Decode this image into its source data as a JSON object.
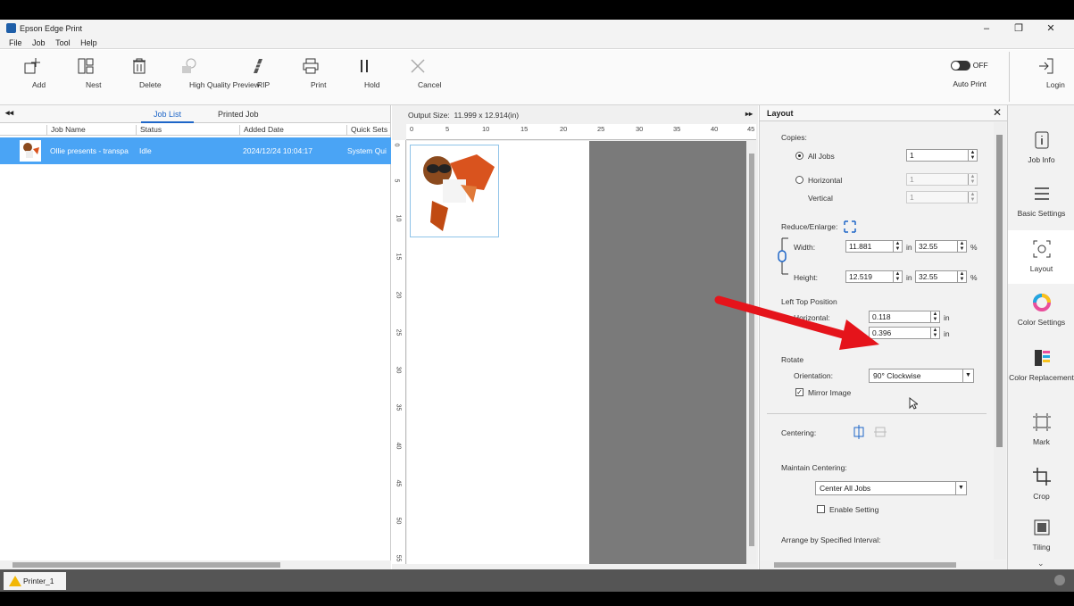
{
  "window": {
    "title": "Epson Edge Print",
    "min": "–",
    "restore": "❐",
    "close": "✕"
  },
  "menu": [
    "File",
    "Job",
    "Tool",
    "Help"
  ],
  "toolbar": {
    "add": "Add",
    "nest": "Nest",
    "delete": "Delete",
    "hq_preview": "High Quality Preview",
    "rip": "RIP",
    "print": "Print",
    "hold": "Hold",
    "cancel": "Cancel",
    "auto_print_state": "OFF",
    "auto_print": "Auto Print",
    "login": "Login"
  },
  "joblist": {
    "collapse": "◂◂",
    "tab_job_list": "Job List",
    "tab_printed_job": "Printed Job",
    "columns": [
      "Job Name",
      "Status",
      "Added Date",
      "Quick Sets"
    ],
    "rows": [
      {
        "name": "Ollie presents - transpa",
        "status": "Idle",
        "added": "2024/12/24 10:04:17",
        "quick": "System Qui"
      }
    ]
  },
  "preview": {
    "output_size_label": "Output Size:",
    "output_size_value": "11.999 x 12.914(in)",
    "top_ticks": [
      "0",
      "5",
      "10",
      "15",
      "20",
      "25",
      "30",
      "35",
      "40",
      "45"
    ],
    "left_ticks": [
      "0",
      "5",
      "10",
      "15",
      "20",
      "25",
      "30",
      "35",
      "40",
      "45",
      "50",
      "55"
    ],
    "expand": "▸▸"
  },
  "layout": {
    "title": "Layout",
    "close": "✕",
    "copies_label": "Copies:",
    "all_jobs": "All Jobs",
    "all_jobs_value": "1",
    "horizontal": "Horizontal",
    "horizontal_value": "1",
    "vertical": "Vertical",
    "vertical_value": "1",
    "reduce_label": "Reduce/Enlarge:",
    "width_label": "Width:",
    "width_value": "11.881",
    "width_unit": "in",
    "width_pct": "32.55",
    "pct": "%",
    "height_label": "Height:",
    "height_value": "12.519",
    "height_unit": "in",
    "height_pct": "32.55",
    "left_top_label": "Left Top Position",
    "lt_horizontal_label": "Horizontal:",
    "lt_horizontal_value": "0.118",
    "lt_unit": "in",
    "lt_vertical_value": "0.396",
    "rotate_label": "Rotate",
    "orientation_label": "Orientation:",
    "orientation_value": "90° Clockwise",
    "mirror_label": "Mirror Image",
    "centering_label": "Centering:",
    "maintain_label": "Maintain Centering:",
    "maintain_value": "Center All Jobs",
    "enable_label": "Enable Setting",
    "arrange_label": "Arrange by Specified Interval:"
  },
  "sidenav": {
    "job_info": "Job Info",
    "basic": "Basic Settings",
    "layout": "Layout",
    "color": "Color Settings",
    "color_repl": "Color Replacement",
    "mark": "Mark",
    "crop": "Crop",
    "tiling": "Tiling"
  },
  "status": {
    "printer": "Printer_1"
  },
  "colors": {
    "accent": "#1e66c8",
    "selected_row": "#4aa4f5",
    "arrow": "#e5141b"
  }
}
